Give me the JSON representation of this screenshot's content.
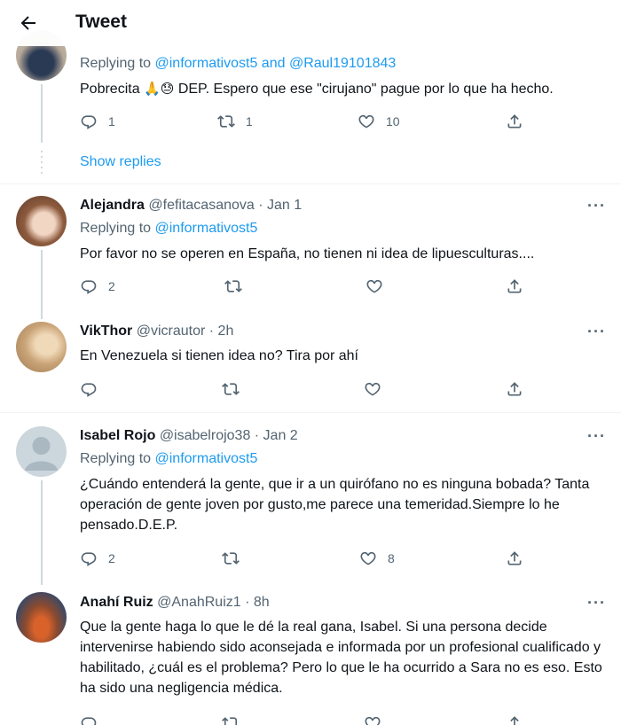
{
  "header": {
    "title": "Tweet"
  },
  "top_tweet": {
    "replying_prefix": "Replying to",
    "mention1": "@informativost5",
    "joiner": "and",
    "mention2": "@Raul19101843",
    "text_before_emoji": "Pobrecita",
    "emoji1": "🙏",
    "emoji2": "😓",
    "text_after_emoji": "DEP. Espero que ese \"cirujano\" pague por lo que ha hecho.",
    "replies": "1",
    "retweets": "1",
    "likes": "10"
  },
  "show_replies": "Show replies",
  "tweets": [
    {
      "name": "Alejandra",
      "meta": "@fefitacasanova · Jan 1",
      "replying_prefix": "Replying to",
      "mention": "@informativost5",
      "text": "Por favor no se operen en España, no tienen ni idea de lipuesculturas....",
      "replies": "2",
      "retweets": "",
      "likes": ""
    },
    {
      "name": "VikThor",
      "meta": "@vicrautor · 2h",
      "text": "En Venezuela si tienen idea no? Tira por ahí",
      "replies": "",
      "retweets": "",
      "likes": ""
    },
    {
      "name": "Isabel Rojo",
      "meta": "@isabelrojo38 · Jan 2",
      "replying_prefix": "Replying to",
      "mention": "@informativost5",
      "text": "¿Cuándo entenderá la gente, que ir a un quirófano no es ninguna bobada? Tanta operación de gente joven por gusto,me parece una temeridad.Siempre lo he pensado.D.E.P.",
      "replies": "2",
      "retweets": "",
      "likes": "8"
    },
    {
      "name": "Anahí Ruiz",
      "meta": "@AnahRuiz1 · 8h",
      "text": "Que la gente haga lo que le dé la real gana, Isabel. Si una persona decide intervenirse habiendo sido aconsejada e informada por un profesional cualificado y habilitado, ¿cuál es el problema? Pero lo que le ha ocurrido a Sara no es eso. Esto ha sido una negligencia médica."
    }
  ],
  "more_glyph": "···"
}
